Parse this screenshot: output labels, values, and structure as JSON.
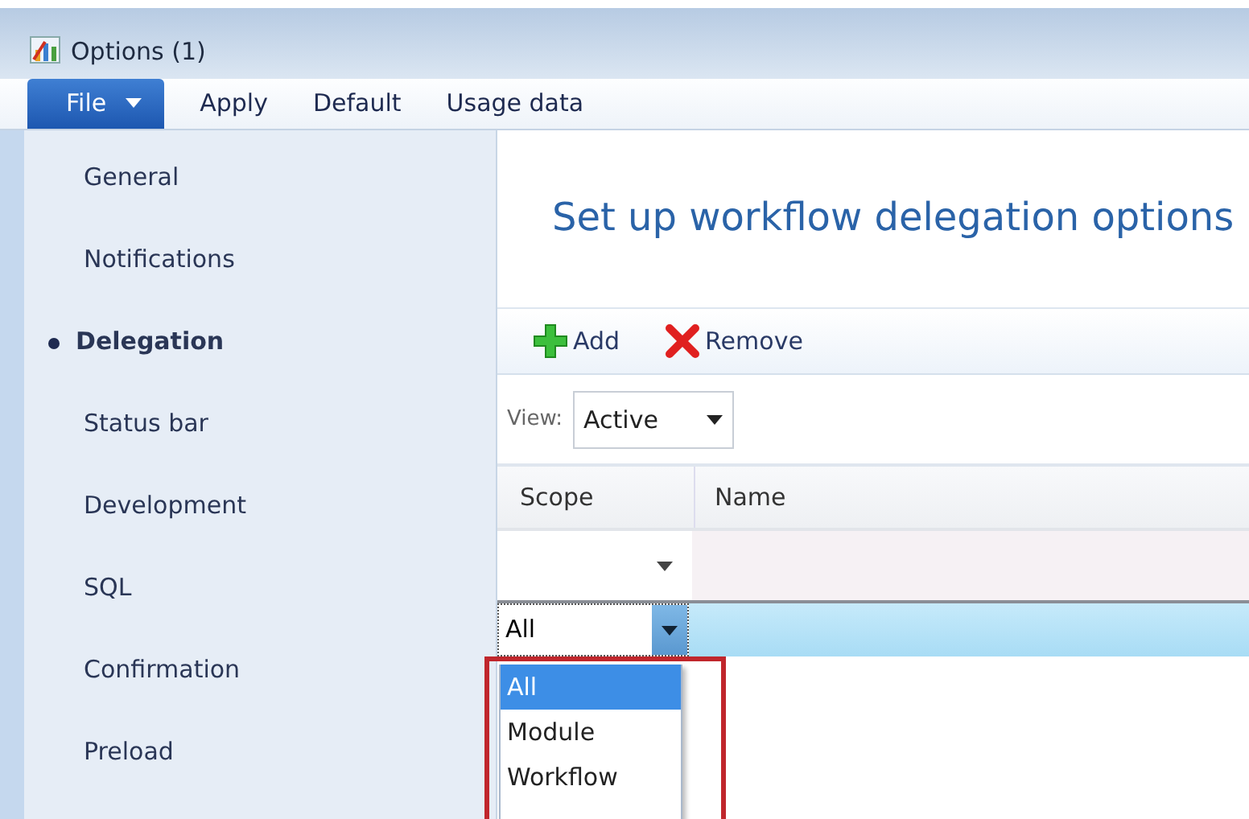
{
  "window": {
    "title": "Options (1)"
  },
  "menu": [
    {
      "label": "File",
      "kind": "file"
    },
    {
      "label": "Apply",
      "kind": "item"
    },
    {
      "label": "Default",
      "kind": "item"
    },
    {
      "label": "Usage data",
      "kind": "item"
    }
  ],
  "sidebar": {
    "items": [
      {
        "label": "General",
        "selected": false
      },
      {
        "label": "Notifications",
        "selected": false
      },
      {
        "label": "Delegation",
        "selected": true
      },
      {
        "label": "Status bar",
        "selected": false
      },
      {
        "label": "Development",
        "selected": false
      },
      {
        "label": "SQL",
        "selected": false
      },
      {
        "label": "Confirmation",
        "selected": false
      },
      {
        "label": "Preload",
        "selected": false
      }
    ]
  },
  "heading": "Set up workflow delegation options",
  "toolbar": [
    {
      "label": "Add",
      "kind": "add"
    },
    {
      "label": "Remove",
      "kind": "remove"
    }
  ],
  "view": {
    "label": "View:",
    "value": "Active"
  },
  "table": {
    "columns": [
      "Scope",
      "Name"
    ],
    "edit_row": {
      "scope": "All"
    }
  },
  "dropdown": {
    "highlighted": true,
    "options": [
      {
        "label": "All",
        "selected": true
      },
      {
        "label": "Module",
        "selected": false
      },
      {
        "label": "Workflow",
        "selected": false
      }
    ]
  }
}
